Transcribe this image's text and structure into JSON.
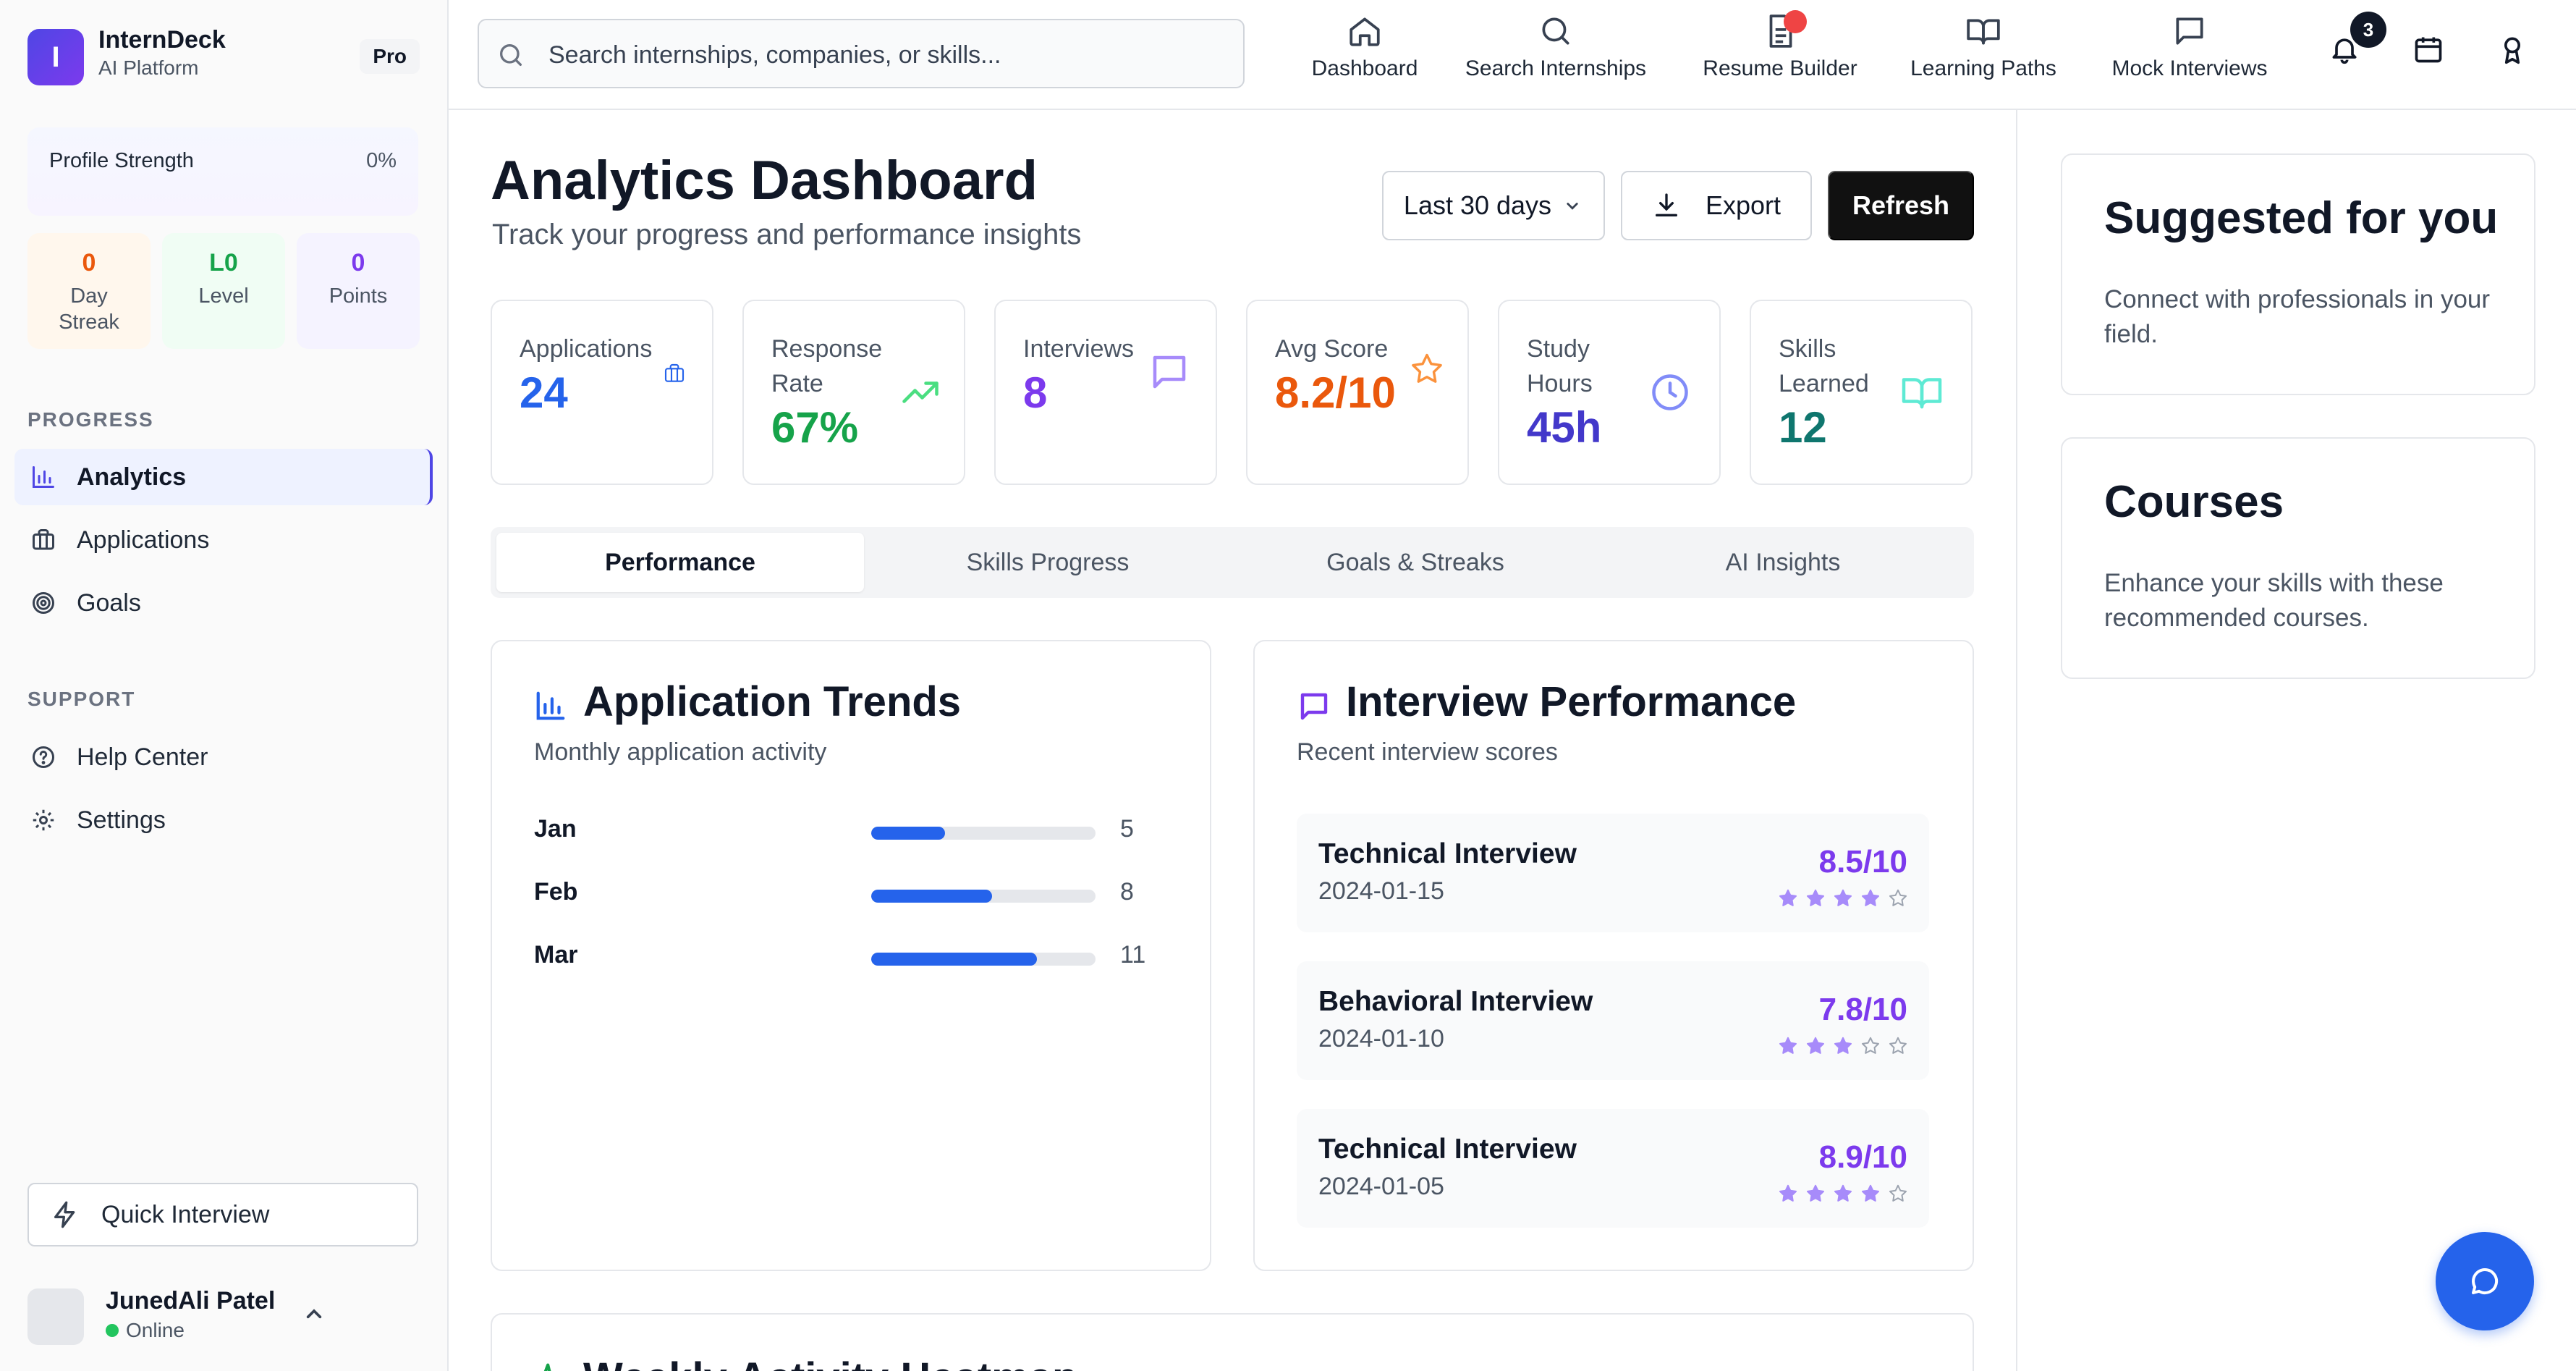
{
  "brand": {
    "name": "InternDeck",
    "subtitle": "AI Platform",
    "badge": "Pro"
  },
  "profile": {
    "label": "Profile Strength",
    "value": "0%",
    "progress_fraction": 0
  },
  "stats": [
    {
      "value": "0",
      "label": "Day Streak",
      "color": "#ea580c"
    },
    {
      "value": "L0",
      "label": "Level",
      "color": "#16a34a"
    },
    {
      "value": "0",
      "label": "Points",
      "color": "#7c3aed"
    }
  ],
  "sidebar": {
    "progress_title": "PROGRESS",
    "progress_items": [
      {
        "label": "Analytics",
        "icon": "bar-chart-icon",
        "active": true
      },
      {
        "label": "Applications",
        "icon": "briefcase-icon",
        "active": false
      },
      {
        "label": "Goals",
        "icon": "target-icon",
        "active": false
      }
    ],
    "support_title": "SUPPORT",
    "support_items": [
      {
        "label": "Help Center",
        "icon": "help-circle-icon"
      },
      {
        "label": "Settings",
        "icon": "gear-icon"
      }
    ],
    "quick_interview": "Quick Interview",
    "user": {
      "name": "JunedAli Patel",
      "status": "Online"
    }
  },
  "topbar": {
    "search_placeholder": "Search internships, companies, or skills...",
    "nav": [
      {
        "label": "Dashboard",
        "icon": "home-icon"
      },
      {
        "label": "Search Internships",
        "icon": "search-icon"
      },
      {
        "label": "Resume Builder",
        "icon": "document-icon"
      },
      {
        "label": "Learning Paths",
        "icon": "book-icon"
      },
      {
        "label": "Mock Interviews",
        "icon": "message-icon"
      }
    ],
    "notification_count": "3"
  },
  "header": {
    "title": "Analytics Dashboard",
    "subtitle": "Track your progress and performance insights",
    "range": "Last 30 days",
    "export": "Export",
    "refresh": "Refresh"
  },
  "kpis": [
    {
      "label": "Applications",
      "value": "24",
      "color": "#2563eb",
      "icon": "briefcase-icon"
    },
    {
      "label": "Response Rate",
      "value": "67%",
      "color": "#16a34a",
      "icon": "trending-up-icon"
    },
    {
      "label": "Interviews",
      "value": "8",
      "color": "#7c3aed",
      "icon": "message-icon"
    },
    {
      "label": "Avg Score",
      "value": "8.2/10",
      "color": "#ea580c",
      "icon": "star-icon"
    },
    {
      "label": "Study Hours",
      "value": "45h",
      "color": "#4338ca",
      "icon": "clock-icon"
    },
    {
      "label": "Skills Learned",
      "value": "12",
      "color": "#0f766e",
      "icon": "book-open-icon"
    }
  ],
  "tabs": [
    "Performance",
    "Skills Progress",
    "Goals & Streaks",
    "AI Insights"
  ],
  "trends": {
    "title": "Application Trends",
    "subtitle": "Monthly application activity",
    "rows": [
      {
        "month": "Jan",
        "value": "5",
        "fraction": 0.33
      },
      {
        "month": "Feb",
        "value": "8",
        "fraction": 0.54
      },
      {
        "month": "Mar",
        "value": "11",
        "fraction": 0.74
      }
    ]
  },
  "interviews": {
    "title": "Interview Performance",
    "subtitle": "Recent interview scores",
    "rows": [
      {
        "type": "Technical Interview",
        "date": "2024-01-15",
        "score": "8.5/10",
        "stars": 4
      },
      {
        "type": "Behavioral Interview",
        "date": "2024-01-10",
        "score": "7.8/10",
        "stars": 3
      },
      {
        "type": "Technical Interview",
        "date": "2024-01-05",
        "score": "8.9/10",
        "stars": 4
      }
    ]
  },
  "heatmap": {
    "title": "Weekly Activity Heatmap"
  },
  "right": {
    "suggested_title": "Suggested for you",
    "suggested_text": "Connect with professionals in your field.",
    "courses_title": "Courses",
    "courses_text": "Enhance your skills with these recommended courses."
  }
}
